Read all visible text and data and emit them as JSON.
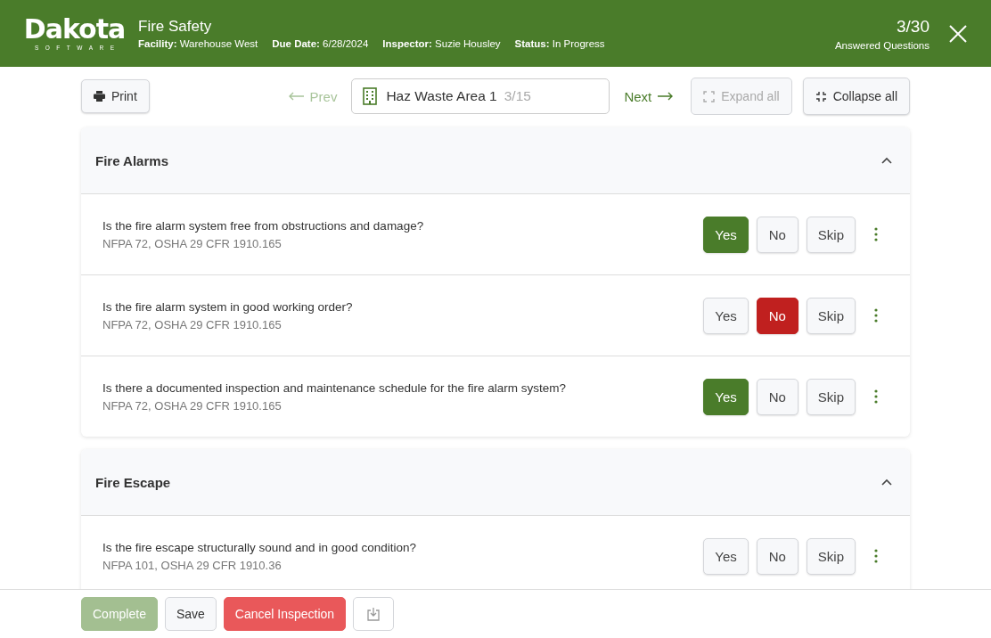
{
  "header": {
    "logo": "Dakota",
    "logo_sub": "SOFTWARE",
    "title": "Fire Safety",
    "meta": [
      {
        "label": "Facility:",
        "value": "Warehouse West"
      },
      {
        "label": "Due Date:",
        "value": "6/28/2024"
      },
      {
        "label": "Inspector:",
        "value": "Suzie Housley"
      },
      {
        "label": "Status:",
        "value": "In Progress"
      }
    ],
    "count": "3/30",
    "count_label": "Answered Questions"
  },
  "toolbar": {
    "print": "Print",
    "prev": {
      "label": "Prev",
      "disabled": true
    },
    "area": {
      "name": "Haz Waste Area 1",
      "position": "3/15"
    },
    "next": {
      "label": "Next",
      "disabled": false
    },
    "expand": {
      "label": "Expand all",
      "disabled": true
    },
    "collapse": {
      "label": "Collapse all",
      "disabled": false
    }
  },
  "sections": [
    {
      "title": "Fire Alarms",
      "expanded": true,
      "questions": [
        {
          "text": "Is the fire alarm system free from obstructions and damage?",
          "reference": "NFPA 72, OSHA 29 CFR 1910.165",
          "options": [
            {
              "kind": "yes",
              "label": "Yes",
              "selected": true
            },
            {
              "kind": "no",
              "label": "No",
              "selected": false
            },
            {
              "kind": "skip",
              "label": "Skip",
              "selected": false
            }
          ]
        },
        {
          "text": "Is the fire alarm system in good working order?",
          "reference": "NFPA 72, OSHA 29 CFR 1910.165",
          "options": [
            {
              "kind": "yes",
              "label": "Yes",
              "selected": false
            },
            {
              "kind": "no",
              "label": "No",
              "selected": true
            },
            {
              "kind": "skip",
              "label": "Skip",
              "selected": false
            }
          ]
        },
        {
          "text": "Is there a documented inspection and maintenance schedule for the fire alarm system?",
          "reference": "NFPA 72, OSHA 29 CFR 1910.165",
          "options": [
            {
              "kind": "yes",
              "label": "Yes",
              "selected": true
            },
            {
              "kind": "no",
              "label": "No",
              "selected": false
            },
            {
              "kind": "skip",
              "label": "Skip",
              "selected": false
            }
          ]
        }
      ]
    },
    {
      "title": "Fire Escape",
      "expanded": true,
      "questions": [
        {
          "text": "Is the fire escape structurally sound and in good condition?",
          "reference": "NFPA 101, OSHA 29 CFR 1910.36",
          "options": [
            {
              "kind": "yes",
              "label": "Yes",
              "selected": false
            },
            {
              "kind": "no",
              "label": "No",
              "selected": false
            },
            {
              "kind": "skip",
              "label": "Skip",
              "selected": false
            }
          ]
        }
      ]
    }
  ],
  "footer": {
    "complete": {
      "label": "Complete",
      "disabled": true
    },
    "save": "Save",
    "cancel": "Cancel Inspection"
  }
}
